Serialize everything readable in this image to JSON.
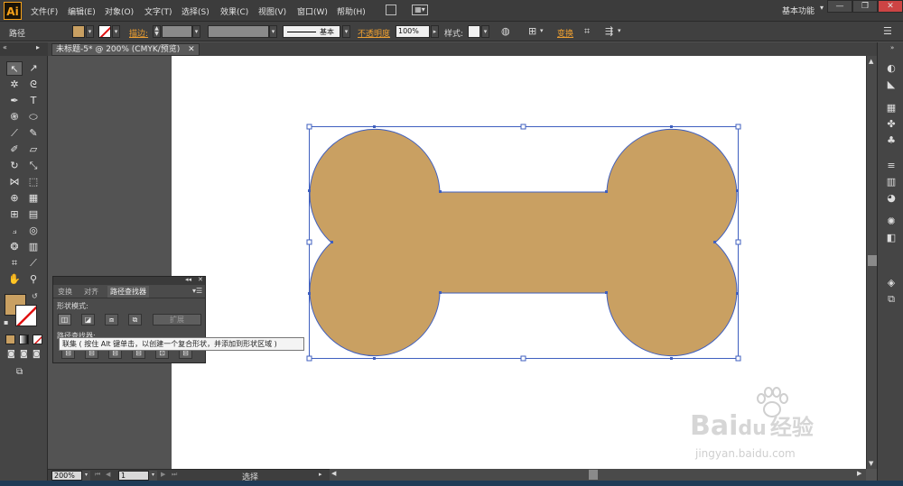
{
  "app": {
    "logo": "Ai"
  },
  "menu": [
    "文件(F)",
    "编辑(E)",
    "对象(O)",
    "文字(T)",
    "选择(S)",
    "效果(C)",
    "视图(V)",
    "窗口(W)",
    "帮助(H)"
  ],
  "workspace": {
    "label": "基本功能"
  },
  "control_bar": {
    "object_type": "路径",
    "stroke_label": "描边:",
    "stroke_style": "基本",
    "opacity_label": "不透明度",
    "opacity_value": "100%",
    "style_label": "样式:",
    "transform_label": "变换",
    "fill_color": "#c9a062"
  },
  "document_tab": {
    "title": "未标题-5* @ 200% (CMYK/预览)"
  },
  "pathfinder_panel": {
    "tabs": [
      "变换",
      "对齐",
      "路径查找器"
    ],
    "active_tab": "路径查找器",
    "shape_modes_label": "形状模式:",
    "expand_label": "扩展",
    "pathfinders_label": "路径查找器:"
  },
  "tooltip": {
    "text": "联集 ( 按住 Alt 键单击，以创建一个复合形状，并添加到形状区域 )"
  },
  "status": {
    "zoom": "200%",
    "page": "1",
    "tool_name": "选择"
  },
  "artwork": {
    "fill": "#c9a062",
    "stroke": "#3f5fbf"
  },
  "watermark": {
    "brand": "Bai",
    "brand_suffix": "du",
    "cn": "经验",
    "url": "jingyan.baidu.com"
  }
}
